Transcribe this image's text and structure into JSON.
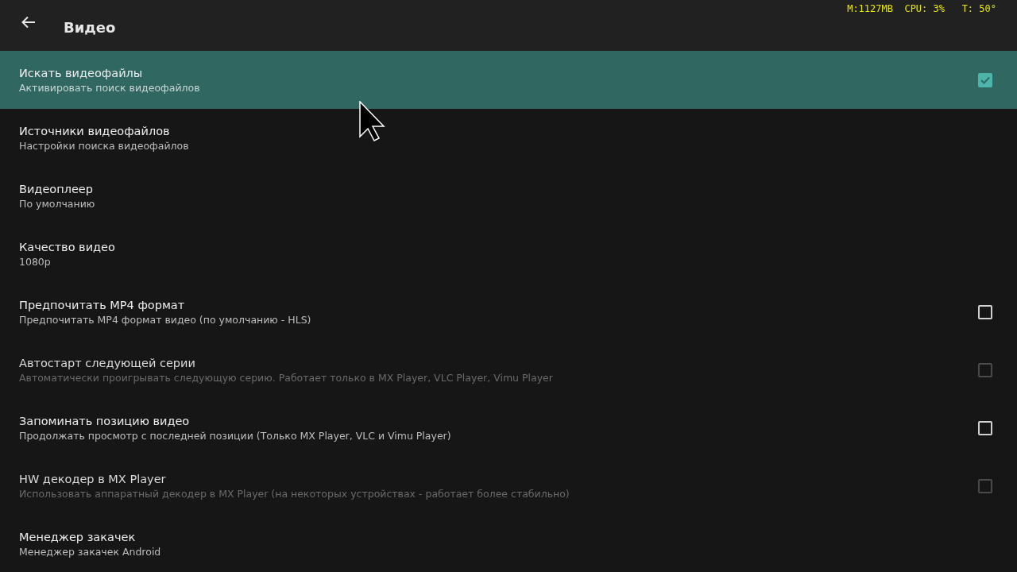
{
  "toolbar": {
    "title": "Видео",
    "stats": "M:1127MB  CPU: 3%   T: 50°"
  },
  "items": [
    {
      "kind": "checkbox",
      "title": "Искать видеофайлы",
      "summary": "Активировать поиск видеофайлов",
      "selected": true,
      "checked": true,
      "disabled": false
    },
    {
      "kind": "plain",
      "title": "Источники видеофайлов",
      "summary": "Настройки поиска видеофайлов",
      "selected": false,
      "disabled": false
    },
    {
      "kind": "plain",
      "title": "Видеоплеер",
      "summary": "По умолчанию",
      "selected": false,
      "disabled": false
    },
    {
      "kind": "plain",
      "title": "Качество видео",
      "summary": "1080p",
      "selected": false,
      "disabled": false
    },
    {
      "kind": "checkbox",
      "title": "Предпочитать MP4 формат",
      "summary": "Предпочитать MP4 формат видео (по умолчанию - HLS)",
      "selected": false,
      "checked": false,
      "disabled": false
    },
    {
      "kind": "checkbox",
      "title": "Автостарт следующей серии",
      "summary": "Автоматически проигрывать следующую серию. Работает только в MX Player, VLC Player, Vimu Player",
      "selected": false,
      "checked": false,
      "disabled": true
    },
    {
      "kind": "checkbox",
      "title": "Запоминать позицию видео",
      "summary": "Продолжать просмотр с последней позиции (Только MX Player, VLC и Vimu Player)",
      "selected": false,
      "checked": false,
      "disabled": false
    },
    {
      "kind": "checkbox",
      "title": "HW декодер в MX Player",
      "summary": "Использовать аппаратный декодер в MX Player (на некоторых устройствах - работает более стабильно)",
      "selected": false,
      "checked": false,
      "disabled": true
    },
    {
      "kind": "plain",
      "title": "Менеджер закачек",
      "summary": "Менеджер закачек Android",
      "selected": false,
      "disabled": false
    }
  ]
}
